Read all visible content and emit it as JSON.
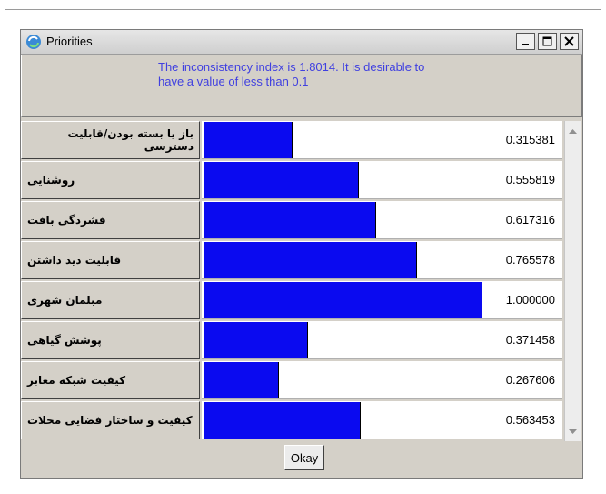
{
  "window": {
    "title": "Priorities",
    "title_icon": "refresh-icon",
    "controls": [
      "minimize-icon",
      "maximize-icon",
      "close-icon"
    ]
  },
  "message": {
    "text": "The inconsistency index is 1.8014.  It is desirable to have a value of less than 0.1"
  },
  "priorities": [
    {
      "label": "باز یا بسته بودن/قابلیت دسترسی",
      "value": "0.315381",
      "weight": 0.315381
    },
    {
      "label": "روشنایی",
      "value": "0.555819",
      "weight": 0.555819
    },
    {
      "label": "فشردگی بافت",
      "value": "0.617316",
      "weight": 0.617316
    },
    {
      "label": "قابلیت دید داشتن",
      "value": "0.765578",
      "weight": 0.765578
    },
    {
      "label": "مبلمان شهری",
      "value": "1.000000",
      "weight": 1.0
    },
    {
      "label": "پوشش گیاهی",
      "value": "0.371458",
      "weight": 0.371458
    },
    {
      "label": "کیفیت شبکه معابر",
      "value": "0.267606",
      "weight": 0.267606
    },
    {
      "label": "کیفیت و ساختار فضایی محلات",
      "value": "0.563453",
      "weight": 0.563453
    }
  ],
  "buttons": {
    "okay_label": "Okay"
  },
  "colors": {
    "bar": "#0a0af0",
    "message_text": "#4040e0"
  }
}
